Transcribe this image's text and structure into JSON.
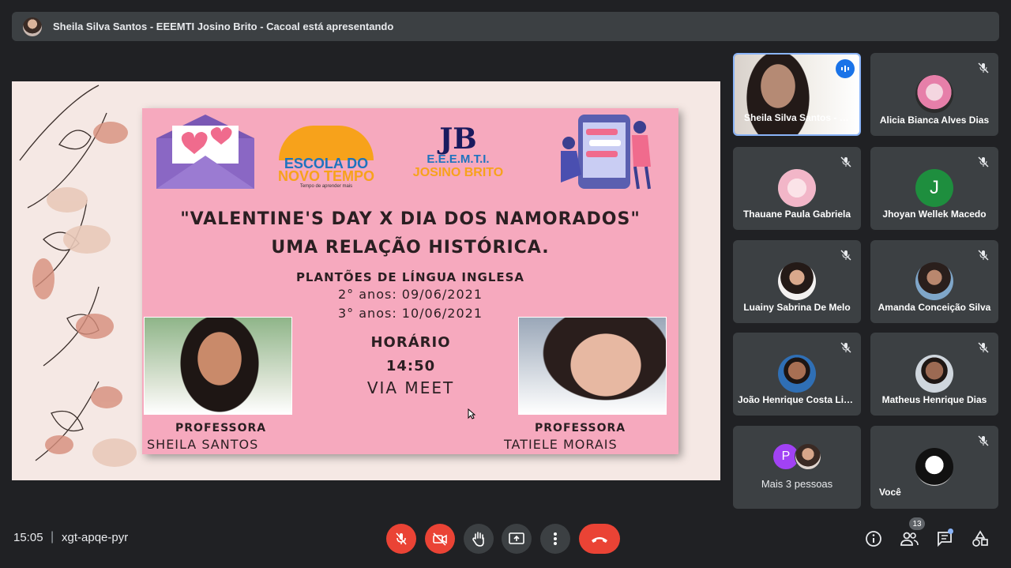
{
  "presenting_banner": "Sheila Silva Santos - EEEMTI Josino Brito - Cacoal está apresentando",
  "slide": {
    "logo_school": [
      "ESCOLA DO",
      "NOVO TEMPO",
      "Tempo de aprender mais"
    ],
    "logo_jb": [
      "JB",
      "E.E.E.M.T.I.",
      "JOSINO BRITO"
    ],
    "title_line1": "\"VALENTINE'S DAY X DIA DOS NAMORADOS\"",
    "title_line2": "UMA RELAÇÃO HISTÓRICA.",
    "subtitle": "PLANTÕES DE LÍNGUA INGLESA",
    "date1": "2° anos: 09/06/2021",
    "date2": "3° anos: 10/06/2021",
    "horario_label": "HORÁRIO",
    "horario_time": "14:50",
    "via": "VIA MEET",
    "prof_left_label": "PROFESSORA",
    "prof_left_name": "SHEILA SANTOS",
    "prof_right_label": "PROFESSORA",
    "prof_right_name": "TATIELE MORAIS"
  },
  "participants": [
    {
      "name": "Sheila Silva Santos - EEEMTI Josino Brito",
      "speaking": true
    },
    {
      "name": "Alicia Bianca Alves Dias",
      "muted": true
    },
    {
      "name": "Thauane Paula Gabriela",
      "muted": true
    },
    {
      "name": "Jhoyan Wellek Macedo",
      "muted": true,
      "initial": "J"
    },
    {
      "name": "Luainy Sabrina De Melo",
      "muted": true
    },
    {
      "name": "Amanda Conceição Silva",
      "muted": true
    },
    {
      "name": "João Henrique Costa Lima",
      "muted": true
    },
    {
      "name": "Matheus Henrique Dias",
      "muted": true
    },
    {
      "name": "Mais 3 pessoas",
      "initial": "P"
    },
    {
      "name": "Você",
      "muted": true
    }
  ],
  "bottom": {
    "time": "15:05",
    "separator": "|",
    "meeting_code": "xgt-apqe-pyr",
    "participants_count": "13"
  },
  "colors": {
    "background": "#202124",
    "tile": "#3c4043",
    "danger": "#ea4335",
    "accent": "#8ab4f8"
  }
}
